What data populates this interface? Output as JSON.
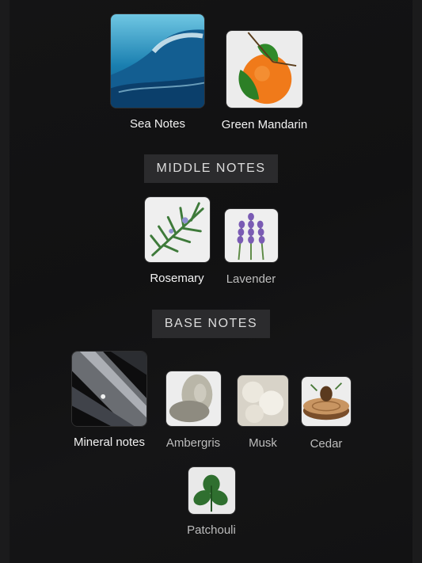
{
  "top_notes": [
    {
      "label": "Sea Notes",
      "image": "ocean-wave-image"
    },
    {
      "label": "Green Mandarin",
      "image": "mandarin-image"
    }
  ],
  "middle": {
    "heading": "MIDDLE NOTES",
    "notes": [
      {
        "label": "Rosemary",
        "image": "rosemary-image"
      },
      {
        "label": "Lavender",
        "image": "lavender-image"
      }
    ]
  },
  "base": {
    "heading": "BASE NOTES",
    "notes": [
      {
        "label": "Mineral notes",
        "image": "mineral-image"
      },
      {
        "label": "Ambergris",
        "image": "ambergris-image"
      },
      {
        "label": "Musk",
        "image": "musk-image"
      },
      {
        "label": "Cedar",
        "image": "cedar-image"
      },
      {
        "label": "Patchouli",
        "image": "patchouli-image"
      }
    ]
  }
}
